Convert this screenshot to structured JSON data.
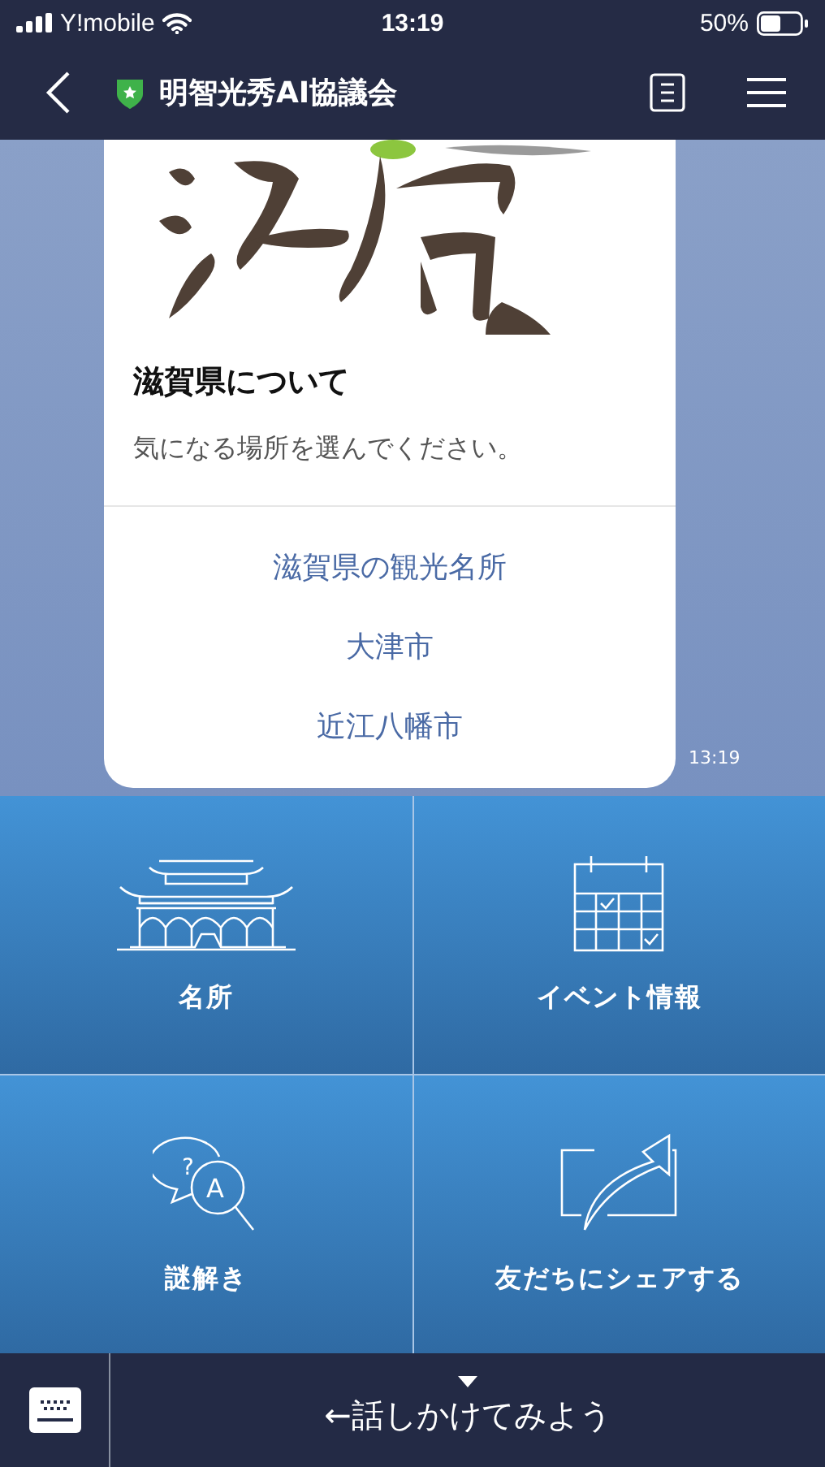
{
  "status_bar": {
    "carrier": "Y!mobile",
    "time": "13:19",
    "battery": "50%"
  },
  "header": {
    "title": "明智光秀AI協議会"
  },
  "message": {
    "title": "滋賀県について",
    "text": "気になる場所を選んでください。",
    "actions": [
      "滋賀県の観光名所",
      "大津市",
      "近江八幡市"
    ],
    "time": "13:19"
  },
  "rich_menu": [
    {
      "kind": "temple",
      "label": "名所"
    },
    {
      "kind": "calendar",
      "label": "イベント情報"
    },
    {
      "kind": "quiz",
      "label": "謎解き",
      "glyphs": [
        "?",
        "A"
      ]
    },
    {
      "kind": "share",
      "label": "友だちにシェアする"
    }
  ],
  "input_bar": {
    "hint": "←話しかけてみよう"
  }
}
